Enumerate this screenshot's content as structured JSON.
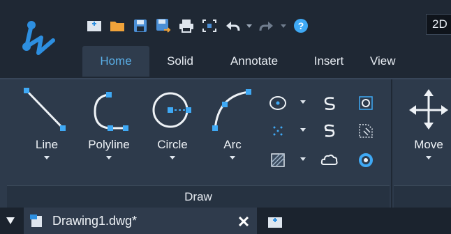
{
  "quick_access": {
    "icons": [
      "new-file-icon",
      "open-folder-icon",
      "save-icon",
      "save-as-icon",
      "print-icon",
      "zoom-extents-icon",
      "undo-icon",
      "redo-icon",
      "help-icon"
    ],
    "workspace_value": "2D"
  },
  "ribbon_tabs": [
    "Home",
    "Solid",
    "Annotate",
    "Insert",
    "View"
  ],
  "active_tab": "Home",
  "draw_panel": {
    "title": "Draw",
    "tools": [
      "Line",
      "Polyline",
      "Circle",
      "Arc"
    ]
  },
  "next_panel": {
    "tools": [
      "Move"
    ]
  },
  "document": {
    "tab_name": "Drawing1.dwg*"
  },
  "colors": {
    "accent": "#3fa9f5",
    "brand_blue": "#2d8fe0",
    "text": "#e6ebf1"
  }
}
